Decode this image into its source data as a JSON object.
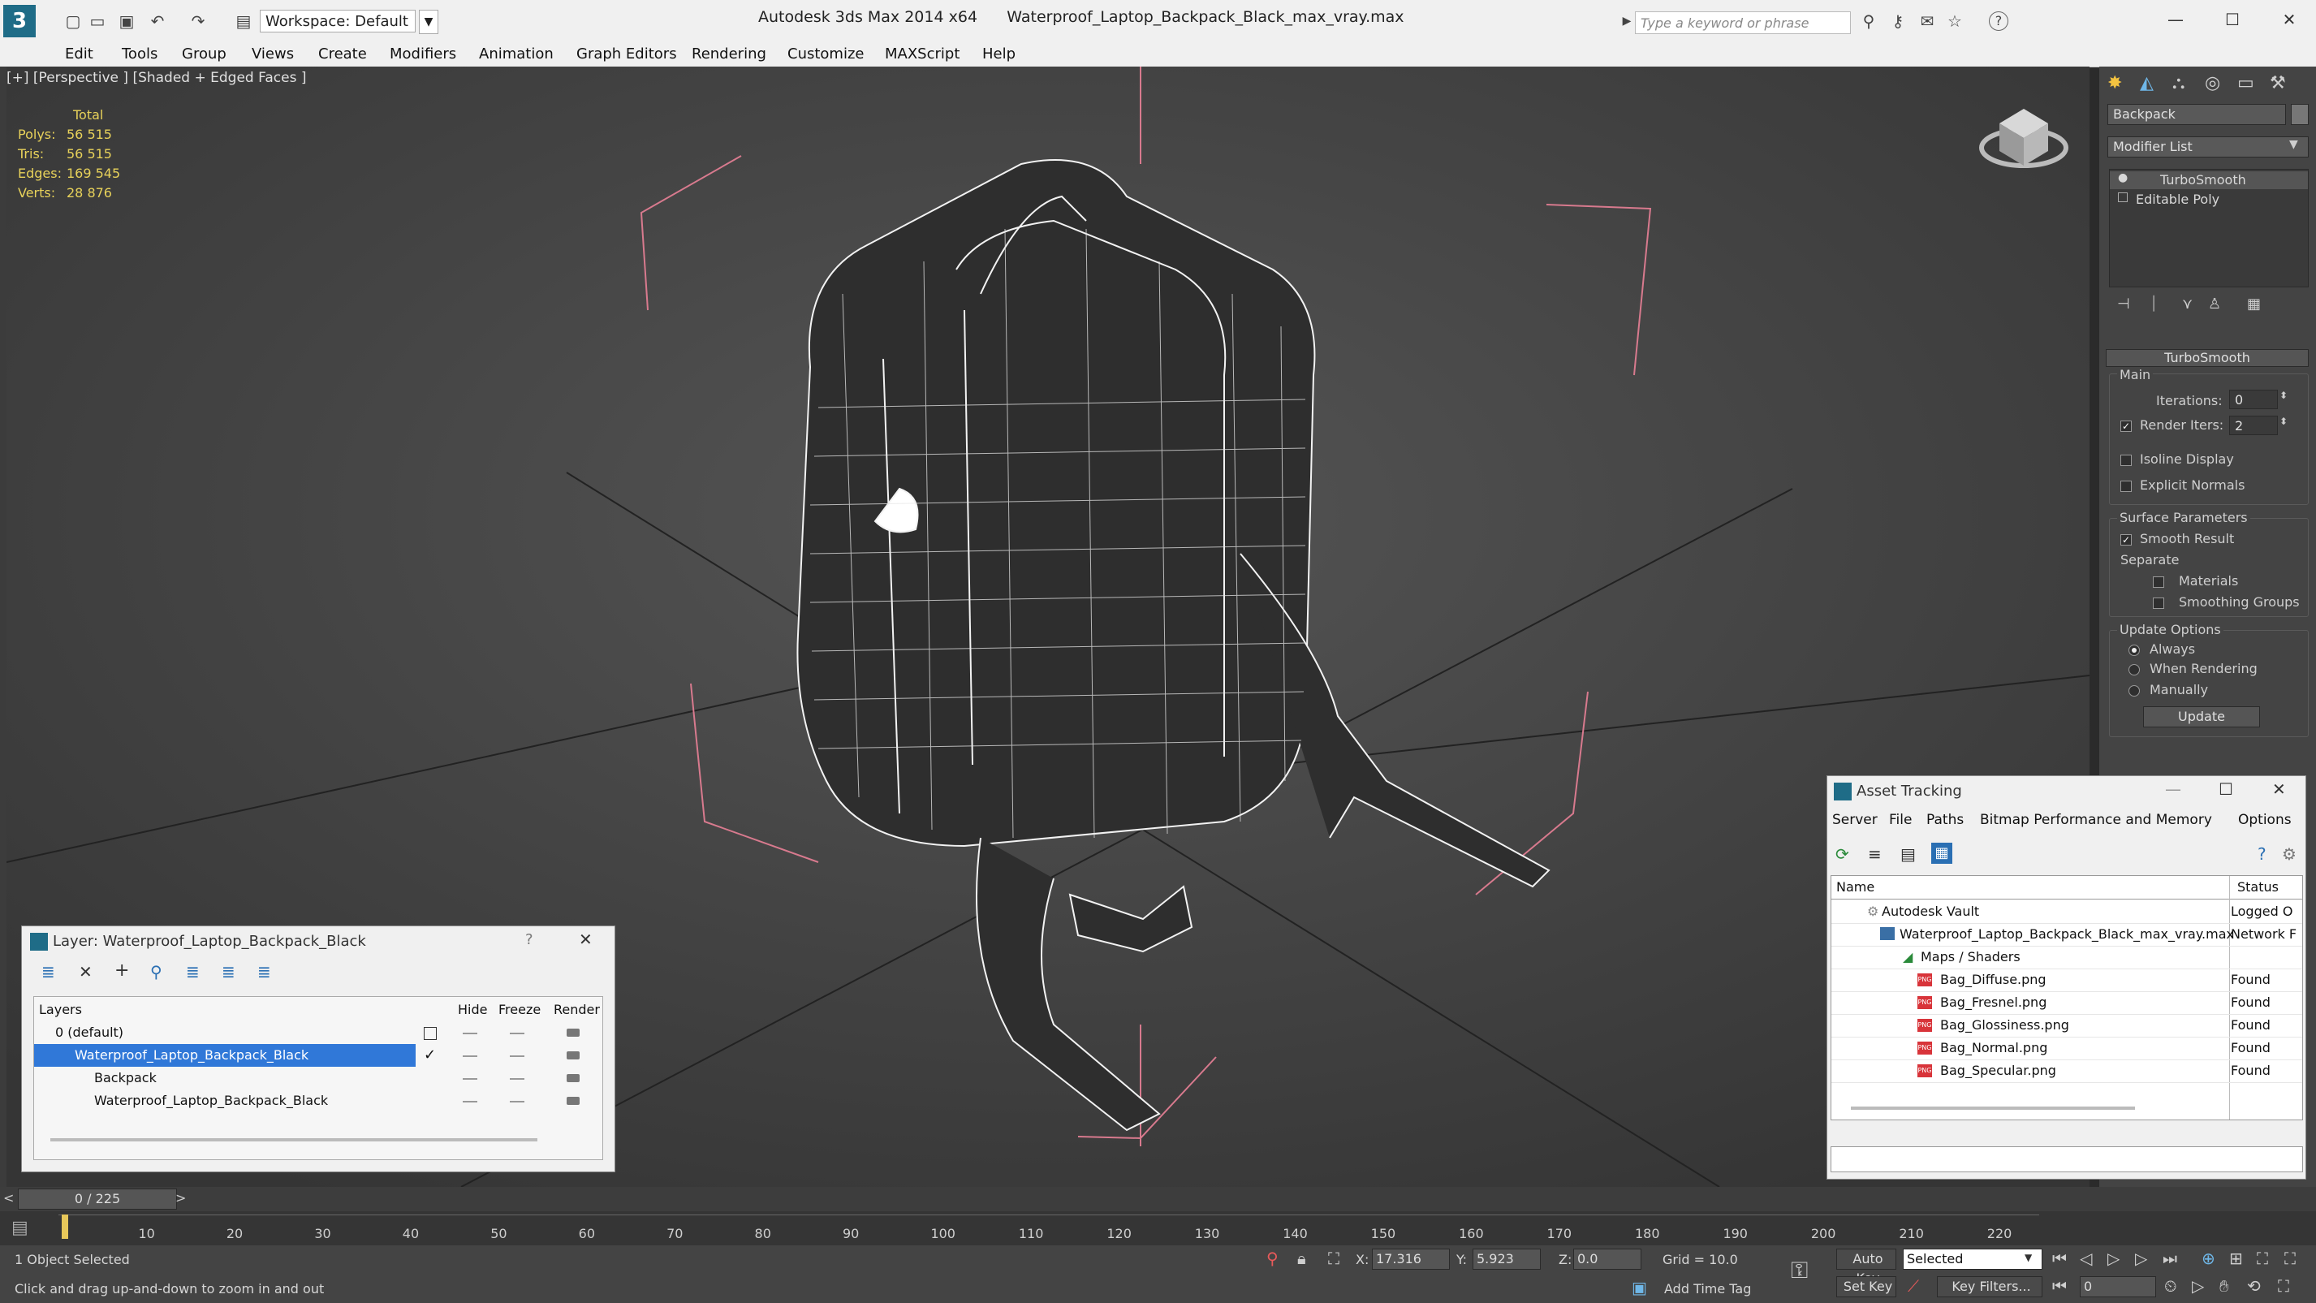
{
  "titlebar": {
    "workspace": "Workspace: Default",
    "app_title": "Autodesk 3ds Max  2014 x64",
    "file_title": "Waterproof_Laptop_Backpack_Black_max_vray.max",
    "search_placeholder": "Type a keyword or phrase",
    "help_icon": "?"
  },
  "menu": [
    "Edit",
    "Tools",
    "Group",
    "Views",
    "Create",
    "Modifiers",
    "Animation",
    "Graph Editors",
    "Rendering",
    "Customize",
    "MAXScript",
    "Help"
  ],
  "viewport": {
    "label": "[+] [Perspective ] [Shaded + Edged Faces ]",
    "stats": {
      "header": "Total",
      "rows": [
        {
          "label": "Polys:",
          "value": "56 515"
        },
        {
          "label": "Tris:",
          "value": "56 515"
        },
        {
          "label": "Edges:",
          "value": "169 545"
        },
        {
          "label": "Verts:",
          "value": "28 876"
        }
      ]
    }
  },
  "command_panel": {
    "object_name": "Backpack",
    "modifier_list": "Modifier List",
    "stack": [
      "TurboSmooth",
      "Editable Poly"
    ],
    "rollout_title": "TurboSmooth",
    "main_label": "Main",
    "iterations_label": "Iterations:",
    "iterations_value": "0",
    "render_iters_label": "Render Iters:",
    "render_iters_value": "2",
    "isoline": "Isoline Display",
    "explicit_normals": "Explicit Normals",
    "surface_params": "Surface Parameters",
    "smooth_result": "Smooth Result",
    "separate": "Separate",
    "materials": "Materials",
    "smoothing_groups": "Smoothing Groups",
    "update_options": "Update Options",
    "always": "Always",
    "when_rendering": "When Rendering",
    "manually": "Manually",
    "update_button": "Update"
  },
  "layer_dialog": {
    "title": "Layer: Waterproof_Laptop_Backpack_Black",
    "help": "?",
    "columns": {
      "layers": "Layers",
      "hide": "Hide",
      "freeze": "Freeze",
      "render": "Render"
    },
    "rows": [
      "0 (default)",
      "Waterproof_Laptop_Backpack_Black",
      "Backpack",
      "Waterproof_Laptop_Backpack_Black"
    ]
  },
  "asset_dialog": {
    "title": "Asset Tracking",
    "menu": [
      "Server",
      "File",
      "Paths",
      "Bitmap Performance and Memory",
      "Options"
    ],
    "columns": {
      "name": "Name",
      "status": "Status"
    },
    "rows": [
      {
        "name": "Autodesk Vault",
        "status": "Logged O"
      },
      {
        "name": "Waterproof_Laptop_Backpack_Black_max_vray.max",
        "status": "Network F"
      },
      {
        "name": "Maps / Shaders",
        "status": ""
      },
      {
        "name": "Bag_Diffuse.png",
        "status": "Found"
      },
      {
        "name": "Bag_Fresnel.png",
        "status": "Found"
      },
      {
        "name": "Bag_Glossiness.png",
        "status": "Found"
      },
      {
        "name": "Bag_Normal.png",
        "status": "Found"
      },
      {
        "name": "Bag_Specular.png",
        "status": "Found"
      }
    ],
    "png_tag": "PNG"
  },
  "timeline": {
    "frame": "0 / 225",
    "ticks": [
      "10",
      "20",
      "30",
      "40",
      "50",
      "60",
      "70",
      "80",
      "90",
      "100",
      "110",
      "120",
      "130",
      "140",
      "150",
      "160",
      "170",
      "180",
      "190",
      "200",
      "210",
      "220"
    ],
    "prev": "<",
    "next": ">"
  },
  "statusbar": {
    "selected": "1 Object Selected",
    "hint": "Click and drag up-and-down to zoom in and out",
    "x_label": "X:",
    "x_value": "17.316",
    "y_label": "Y:",
    "y_value": "5.923",
    "z_label": "Z:",
    "z_value": "0.0",
    "grid": "Grid = 10.0",
    "auto_key": "Auto Key",
    "selected_dropdown": "Selected",
    "set_key": "Set Key",
    "key_filters": "Key Filters...",
    "add_time_tag": "Add Time Tag",
    "frame_value": "0"
  },
  "colors": {
    "viewport_bg": "#444444",
    "selection_blue": "#3078d8",
    "stats_yellow": "#e8d25a",
    "bbox_pink": "#d87a8e"
  }
}
